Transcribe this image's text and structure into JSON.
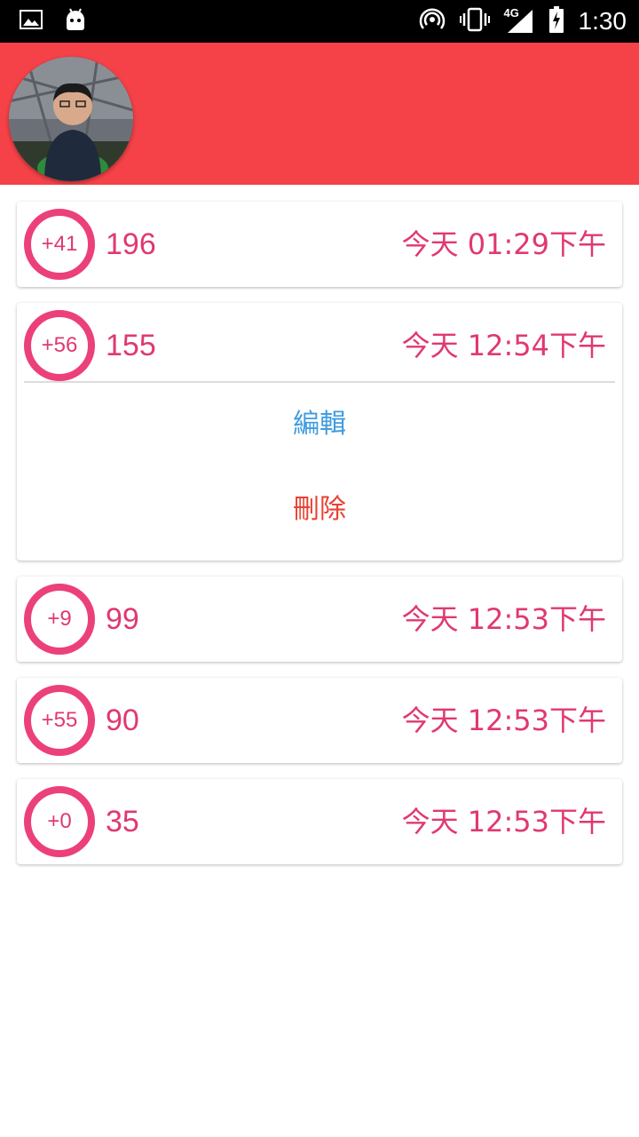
{
  "status_bar": {
    "network": "4G",
    "time": "1:30"
  },
  "colors": {
    "header": "#f44248",
    "accent": "#e0396f",
    "edit": "#3f9de0",
    "delete": "#e84234"
  },
  "records": [
    {
      "badge": "+41",
      "value": "196",
      "time": "今天 01:29下午"
    },
    {
      "badge": "+56",
      "value": "155",
      "time": "今天 12:54下午",
      "expanded": true,
      "edit_label": "編輯",
      "delete_label": "刪除"
    },
    {
      "badge": "+9",
      "value": "99",
      "time": "今天 12:53下午"
    },
    {
      "badge": "+55",
      "value": "90",
      "time": "今天 12:53下午"
    },
    {
      "badge": "+0",
      "value": "35",
      "time": "今天 12:53下午"
    }
  ]
}
